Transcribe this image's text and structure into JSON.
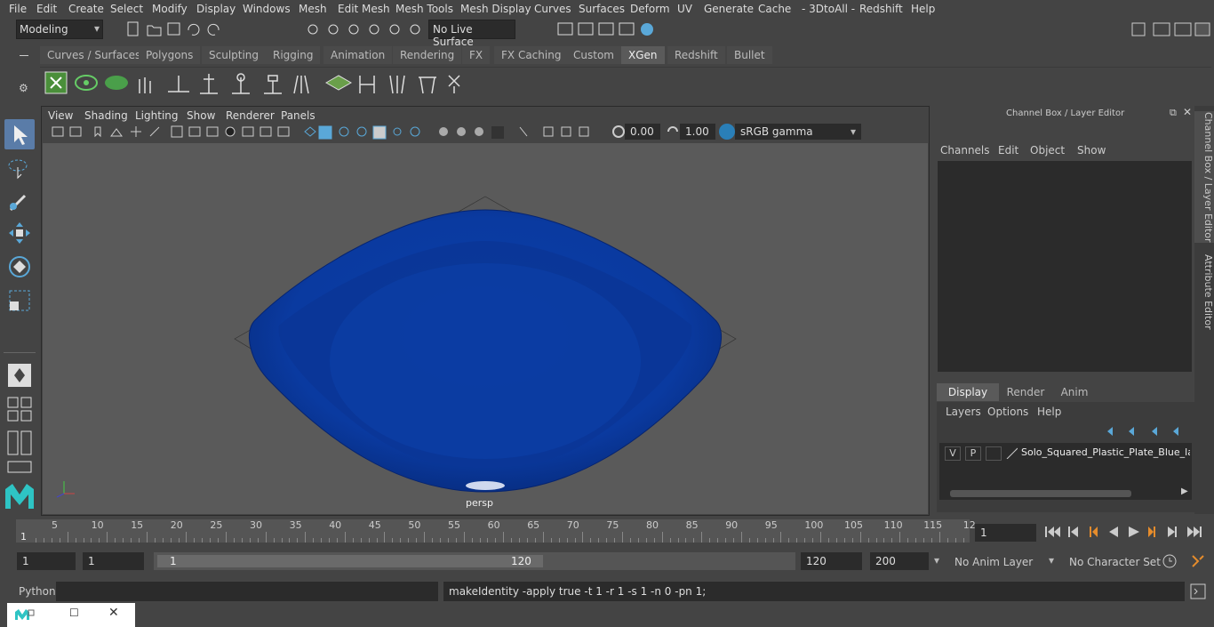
{
  "menu": [
    "File",
    "Edit",
    "Create",
    "Select",
    "Modify",
    "Display",
    "Windows",
    "Mesh",
    "Edit Mesh",
    "Mesh Tools",
    "Mesh Display",
    "Curves",
    "Surfaces",
    "Deform",
    "UV",
    "Generate",
    "Cache",
    "- 3DtoAll -",
    "Redshift",
    "Help"
  ],
  "toolbar": {
    "mode": "Modeling",
    "live_surface": "No Live Surface"
  },
  "shelf_tabs": [
    "Curves / Surfaces",
    "Polygons",
    "Sculpting",
    "Rigging",
    "Animation",
    "Rendering",
    "FX",
    "FX Caching",
    "Custom",
    "XGen",
    "Redshift",
    "Bullet"
  ],
  "shelf_active": "XGen",
  "viewport": {
    "menu": [
      "View",
      "Shading",
      "Lighting",
      "Show",
      "Renderer",
      "Panels"
    ],
    "exposure": "0.00",
    "gamma": "1.00",
    "colorspace": "sRGB gamma",
    "camera": "persp"
  },
  "channel_box": {
    "title": "Channel Box / Layer Editor",
    "menu": [
      "Channels",
      "Edit",
      "Object",
      "Show"
    ],
    "tabs": [
      "Display",
      "Render",
      "Anim"
    ],
    "layer_menu": [
      "Layers",
      "Options",
      "Help"
    ],
    "layer": {
      "v": "V",
      "p": "P",
      "name": "Solo_Squared_Plastic_Plate_Blue_laye"
    }
  },
  "side_tabs": [
    "Channel Box / Layer Editor",
    "Attribute Editor"
  ],
  "timeline": {
    "ticks": [
      "5",
      "10",
      "15",
      "20",
      "25",
      "30",
      "35",
      "40",
      "45",
      "50",
      "55",
      "60",
      "65",
      "70",
      "75",
      "80",
      "85",
      "90",
      "95",
      "100",
      "105",
      "110",
      "115",
      "12"
    ],
    "start_marker": "1",
    "current_frame": "1"
  },
  "range": {
    "start": "1",
    "anim_start": "1",
    "slider_start": "1",
    "slider_end": "120",
    "end": "120",
    "anim_end": "200",
    "anim_layer": "No Anim Layer",
    "char_set": "No Character Set"
  },
  "command": {
    "lang": "Python",
    "result": "makeIdentity -apply true -t 1 -r 1 -s 1 -n 0 -pn 1;"
  },
  "colors": {
    "plate": "#0a3aa0",
    "accent": "#5a9fd4"
  }
}
